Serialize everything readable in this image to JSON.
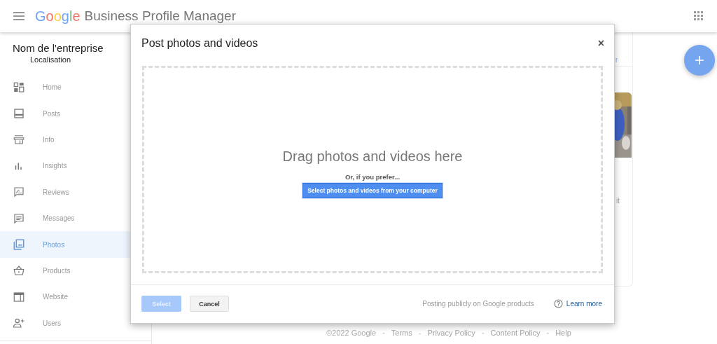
{
  "header": {
    "logo": "Google",
    "title": "Business Profile Manager"
  },
  "business": {
    "name": "Nom de l'entreprise",
    "location": "Localisation"
  },
  "sidebar": {
    "items": [
      {
        "kind": "home",
        "label": "Home",
        "selected": false
      },
      {
        "kind": "posts",
        "label": "Posts",
        "selected": false
      },
      {
        "kind": "info",
        "label": "Info",
        "selected": false
      },
      {
        "kind": "insights",
        "label": "Insights",
        "selected": false
      },
      {
        "kind": "reviews",
        "label": "Reviews",
        "selected": false
      },
      {
        "kind": "messages",
        "label": "Messages",
        "selected": false
      },
      {
        "kind": "photos",
        "label": "Photos",
        "selected": true
      },
      {
        "kind": "products",
        "label": "Products",
        "selected": false
      },
      {
        "kind": "website",
        "label": "Website",
        "selected": false
      },
      {
        "kind": "users",
        "label": "Users",
        "selected": false
      }
    ]
  },
  "background_card": {
    "link_fragment": "r",
    "text_fragment": "it"
  },
  "dialog": {
    "title": "Post photos and videos",
    "close": "×",
    "drop_text": "Drag photos and videos here",
    "alt_text": "Or, if you prefer...",
    "select_computer_button": "Select photos and videos from your computer",
    "select_button": {
      "label": "Select",
      "disabled": true
    },
    "cancel_button": "Cancel",
    "notice": "Posting publicly on Google products",
    "learn_more": "Learn more"
  },
  "footer": [
    {
      "kind": "text",
      "text": "©2022 Google"
    },
    {
      "kind": "separator",
      "text": "-"
    },
    {
      "kind": "link",
      "text": "Terms"
    },
    {
      "kind": "separator",
      "text": "-"
    },
    {
      "kind": "link",
      "text": "Privacy Policy"
    },
    {
      "kind": "separator",
      "text": "-"
    },
    {
      "kind": "link",
      "text": "Content Policy"
    },
    {
      "kind": "separator",
      "text": "-"
    },
    {
      "kind": "link",
      "text": "Help"
    }
  ]
}
